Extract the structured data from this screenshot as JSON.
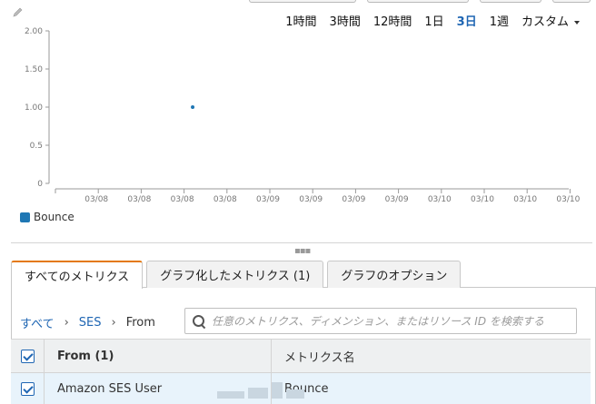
{
  "toolbar": {
    "edit_icon": "pencil-icon"
  },
  "time_ranges": {
    "options": [
      "1時間",
      "3時間",
      "12時間",
      "1日",
      "3日",
      "1週",
      "カスタム"
    ],
    "active": "3日"
  },
  "chart_data": {
    "type": "scatter",
    "x_tick_labels": [
      "03/08",
      "03/08",
      "03/08",
      "03/08",
      "03/09",
      "03/09",
      "03/09",
      "03/09",
      "03/10",
      "03/10",
      "03/10",
      "03/10"
    ],
    "y_tick_labels": [
      "2.00",
      "1.50",
      "1.00",
      "0.5",
      "0"
    ],
    "ylim": [
      0,
      2
    ],
    "series": [
      {
        "name": "Bounce",
        "color": "#1f77b4",
        "points": [
          {
            "x_tick_position": 3.2,
            "y": 1.0
          }
        ]
      }
    ],
    "legend": "bottom-left",
    "grid": false
  },
  "legend": {
    "label": "Bounce"
  },
  "tabs": [
    {
      "label": "すべてのメトリクス",
      "active": true
    },
    {
      "label": "グラフ化したメトリクス (1)",
      "active": false
    },
    {
      "label": "グラフのオプション",
      "active": false
    }
  ],
  "breadcrumb": {
    "all": "すべて",
    "namespace": "SES",
    "current": "From"
  },
  "search": {
    "placeholder": "任意のメトリクス、ディメンション、またはリソース ID を検索する",
    "value": ""
  },
  "table": {
    "headers": {
      "from": "From (1)",
      "metric": "メトリクス名"
    },
    "rows": [
      {
        "from": "Amazon SES User",
        "metric": "Bounce",
        "checked": true
      }
    ]
  },
  "colors": {
    "accent": "#1f66b3",
    "tab_highlight": "#e47911",
    "series": "#1f77b4"
  }
}
